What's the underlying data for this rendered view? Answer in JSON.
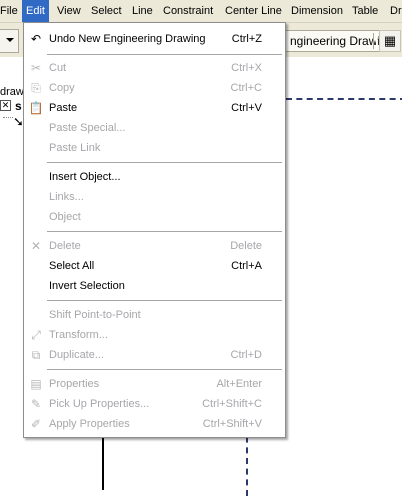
{
  "menubar": {
    "items": [
      "File",
      "Edit",
      "View",
      "Select",
      "Line",
      "Constraint",
      "Center Line",
      "Dimension",
      "Table",
      "Dr"
    ]
  },
  "toolbar": {
    "drawing_button_label": "ngineering Drawing"
  },
  "tree": {
    "title": "draw",
    "root_label": "s"
  },
  "edit_menu": {
    "items": [
      {
        "label": "Undo New Engineering Drawing",
        "shortcut": "Ctrl+Z",
        "enabled": true,
        "icon": "undo-icon"
      },
      {
        "label": "Cut",
        "shortcut": "Ctrl+X",
        "enabled": false,
        "icon": "scissors-icon"
      },
      {
        "label": "Copy",
        "shortcut": "Ctrl+C",
        "enabled": false,
        "icon": "copy-icon"
      },
      {
        "label": "Paste",
        "shortcut": "Ctrl+V",
        "enabled": true,
        "icon": "paste-icon"
      },
      {
        "label": "Paste Special...",
        "shortcut": "",
        "enabled": false,
        "icon": ""
      },
      {
        "label": "Paste Link",
        "shortcut": "",
        "enabled": false,
        "icon": ""
      },
      {
        "label": "Insert Object...",
        "shortcut": "",
        "enabled": true,
        "icon": ""
      },
      {
        "label": "Links...",
        "shortcut": "",
        "enabled": false,
        "icon": ""
      },
      {
        "label": "Object",
        "shortcut": "",
        "enabled": false,
        "icon": ""
      },
      {
        "label": "Delete",
        "shortcut": "Delete",
        "enabled": false,
        "icon": "delete-x-icon"
      },
      {
        "label": "Select All",
        "shortcut": "Ctrl+A",
        "enabled": true,
        "icon": ""
      },
      {
        "label": "Invert Selection",
        "shortcut": "",
        "enabled": true,
        "icon": ""
      },
      {
        "label": "Shift Point-to-Point",
        "shortcut": "",
        "enabled": false,
        "icon": ""
      },
      {
        "label": "Transform...",
        "shortcut": "",
        "enabled": false,
        "icon": "transform-icon"
      },
      {
        "label": "Duplicate...",
        "shortcut": "Ctrl+D",
        "enabled": false,
        "icon": "duplicate-icon"
      },
      {
        "label": "Properties",
        "shortcut": "Alt+Enter",
        "enabled": false,
        "icon": "properties-icon"
      },
      {
        "label": "Pick Up Properties...",
        "shortcut": "Ctrl+Shift+C",
        "enabled": false,
        "icon": "eyedropper-icon"
      },
      {
        "label": "Apply Properties",
        "shortcut": "Ctrl+Shift+V",
        "enabled": false,
        "icon": "apply-properties-icon"
      }
    ]
  },
  "colors": {
    "menubar_bg": "#ece9d8",
    "highlight": "#316ac5",
    "disabled_text": "#a7a6aa",
    "dash_line": "#2b3a6b"
  }
}
